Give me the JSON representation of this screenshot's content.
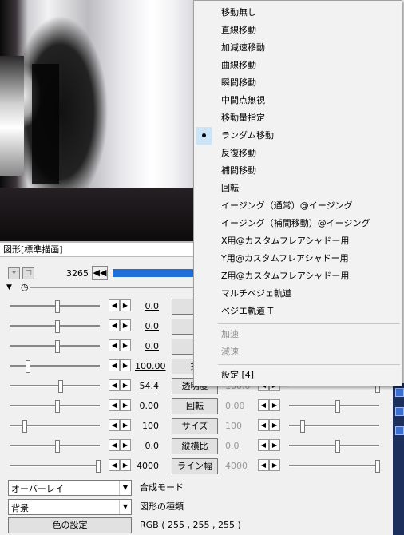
{
  "window_title": "図形[標準描画]",
  "frame_number": "3265",
  "menu": {
    "items": [
      "移動無し",
      "直線移動",
      "加減速移動",
      "曲線移動",
      "瞬間移動",
      "中間点無視",
      "移動量指定",
      "ランダム移動",
      "反復移動",
      "補間移動",
      "回転",
      "イージング（通常）@イージング",
      "イージング（補間移動）@イージング",
      "X用@カスタムフレアシャドー用",
      "Y用@カスタムフレアシャドー用",
      "Z用@カスタムフレアシャドー用",
      "マルチベジェ軌道",
      "ベジエ軌道 T"
    ],
    "selected_index": 7,
    "disabled_items": [
      "加速",
      "減速"
    ],
    "settings": "設定 [4]"
  },
  "params": [
    {
      "value": "0.0",
      "button": "",
      "value2": ""
    },
    {
      "value": "0.0",
      "button": "",
      "value2": ""
    },
    {
      "value": "0.0",
      "button": "",
      "value2": ""
    },
    {
      "value": "100.00",
      "button": "拡",
      "value2": ""
    },
    {
      "value": "54.4",
      "button": "透明度",
      "value2": "100.0"
    },
    {
      "value": "0.00",
      "button": "回転",
      "value2": "0.00"
    },
    {
      "value": "100",
      "button": "サイズ",
      "value2": "100"
    },
    {
      "value": "0.0",
      "button": "縦横比",
      "value2": "0.0"
    },
    {
      "value": "4000",
      "button": "ライン幅",
      "value2": "4000"
    }
  ],
  "blend_mode": {
    "value": "オーバーレイ",
    "label": "合成モード"
  },
  "shape_type": {
    "value": "背景",
    "label": "図形の種類"
  },
  "color_button": "色の設定",
  "rgb_text": "RGB ( 255 , 255 , 255 )",
  "colors": {
    "accent": "#1e6fd9",
    "menu_highlight": "#cce4f7"
  }
}
